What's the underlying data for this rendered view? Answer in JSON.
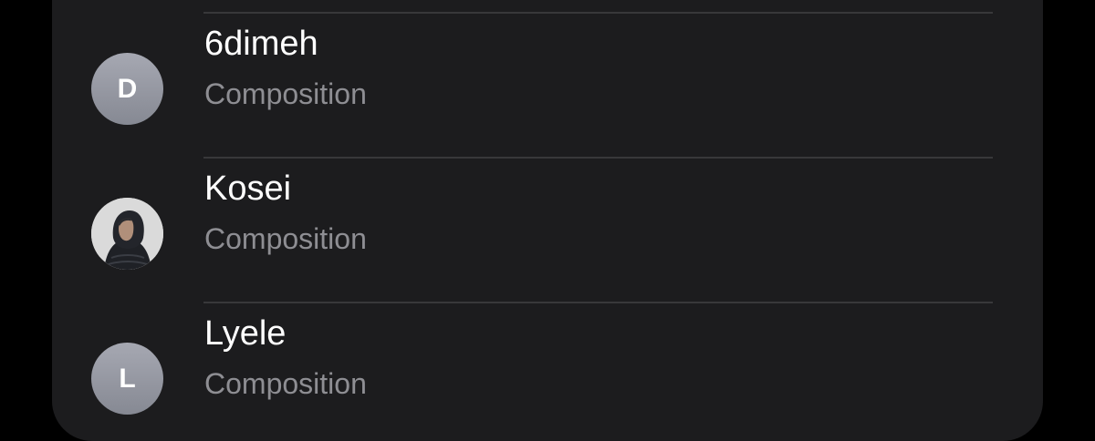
{
  "contacts": [
    {
      "initial": "D",
      "name": "6dimeh",
      "subtitle": "Composition",
      "avatar": "initial"
    },
    {
      "initial": "",
      "name": "Kosei",
      "subtitle": "Composition",
      "avatar": "photo"
    },
    {
      "initial": "L",
      "name": "Lyele",
      "subtitle": "Composition",
      "avatar": "initial"
    }
  ],
  "colors": {
    "background": "#000000",
    "card": "#1c1c1e",
    "divider": "#38383a",
    "primary_text": "#ffffff",
    "secondary_text": "#8e8e93",
    "avatar_top": "#a6a8b2",
    "avatar_bottom": "#868993"
  }
}
